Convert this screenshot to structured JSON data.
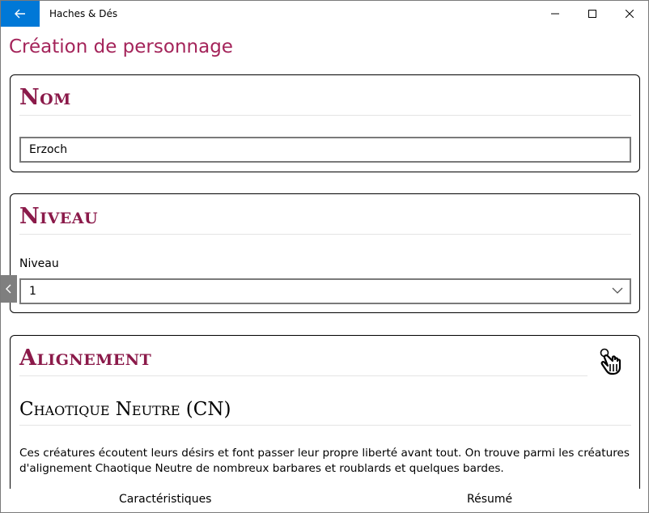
{
  "window": {
    "title": "Haches & Dés",
    "back_icon": "arrow-left-icon",
    "accent_color": "#0078d7"
  },
  "page": {
    "title": "Création de personnage",
    "title_color": "#a4245a"
  },
  "name_section": {
    "heading": "Nom",
    "value": "Erzoch"
  },
  "level_section": {
    "heading": "Niveau",
    "label": "Niveau",
    "selected": "1"
  },
  "alignment_section": {
    "heading": "Alignement",
    "current_title": "Chaotique Neutre (CN)",
    "description": "Ces créatures écoutent leurs désirs et font passer leur propre liberté avant tout. On trouve parmi les créatures d'alignement Chaotique Neutre de nombreux barbares et roublards et quelques bardes.",
    "icon": "pointing-hand-icon"
  },
  "bottom_nav": {
    "left": "Caractéristiques",
    "right": "Résumé"
  },
  "heading_color": "#8b1a4a"
}
